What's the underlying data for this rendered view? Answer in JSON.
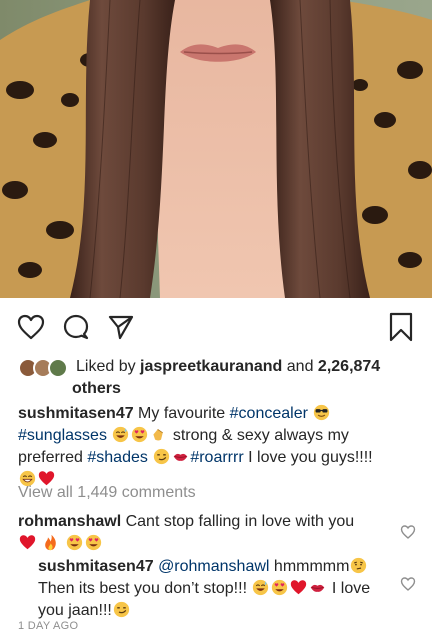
{
  "post": {
    "likes_prefix": "Liked by ",
    "liked_by_user": "jaspreetkauranand",
    "likes_and": " and ",
    "likes_count": "2,26,874",
    "likes_suffix": " others"
  },
  "caption": {
    "username": "sushmitasen47",
    "text1": " My favourite ",
    "tag_concealer": "#concealer",
    "tag_sunglasses": "#sunglasses",
    "text2": " strong & sexy always my preferred ",
    "tag_shades": "#shades",
    "tag_roarrrr": "#roarrrr",
    "text3": " I love you guys!!!!"
  },
  "view_all_comments": "View all 1,449 comments",
  "comments": [
    {
      "username": "rohmanshawl",
      "text": " Cant stop falling in love with you"
    },
    {
      "username": "sushmitasen47",
      "mention": "@rohmanshawl",
      "text1": " hmmmmm",
      "text2": "Then its best you don’t stop!!! ",
      "text3": "I love you jaan!!!"
    }
  ],
  "timestamp": "1 DAY AGO",
  "icons": [
    "heart-icon",
    "comment-icon",
    "share-icon",
    "bookmark-icon"
  ]
}
